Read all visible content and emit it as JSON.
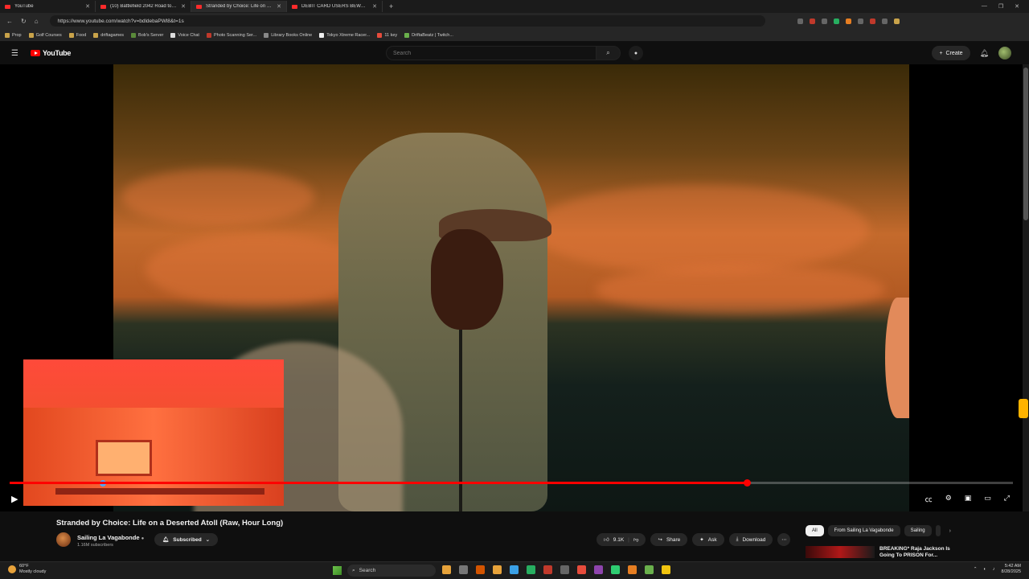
{
  "browser": {
    "tabs": [
      {
        "label": "YouTube",
        "active": false
      },
      {
        "label": "(10) Battlefield 2042 Road to Bat",
        "active": false
      },
      {
        "label": "Stranded by Choice: Life on a De",
        "active": true
      },
      {
        "label": "DEBIT CARD USERS BEWARE: Ta",
        "active": false
      }
    ],
    "new_tab": "+",
    "url": "https://www.youtube.com/watch?v=bdldebaPWl8&t=1s",
    "bookmarks": [
      "Prop",
      "Golf Courses",
      "Food",
      "driftagames",
      "Bob's Server",
      "Voice Chat",
      "Photo Scanning Ser...",
      "Library Books Online",
      "Tokyo Xtreme Racer...",
      "11 key",
      "DriftaBeatz | Twitch..."
    ]
  },
  "header": {
    "logo_text": "YouTube",
    "search_placeholder": "Search",
    "create_label": "Create"
  },
  "video": {
    "progress_fraction": 0.735,
    "title": "Stranded by Choice: Life on a Deserted Atoll (Raw, Hour Long)",
    "channel_name": "Sailing La Vagabonde",
    "channel_verified": "●",
    "subscribers": "1.16M subscribers",
    "subscribe_label": "Subscribed",
    "likes": "9.1K",
    "share_label": "Share",
    "ask_label": "Ask",
    "download_label": "Download"
  },
  "chips": [
    {
      "label": "All",
      "active": true
    },
    {
      "label": "From Sailing La Vagabonde",
      "active": false
    },
    {
      "label": "Sailing",
      "active": false
    }
  ],
  "recommendation": {
    "title": "BREAKING* Raja Jackson Is Going To PRISON For..."
  },
  "taskbar": {
    "temperature": "60°F",
    "weather": "Mostly cloudy",
    "search_label": "Search",
    "time": "5:42 AM",
    "date": "8/28/2025"
  },
  "colors": {
    "accent": "#ff0000",
    "background": "#0f0f0f"
  }
}
